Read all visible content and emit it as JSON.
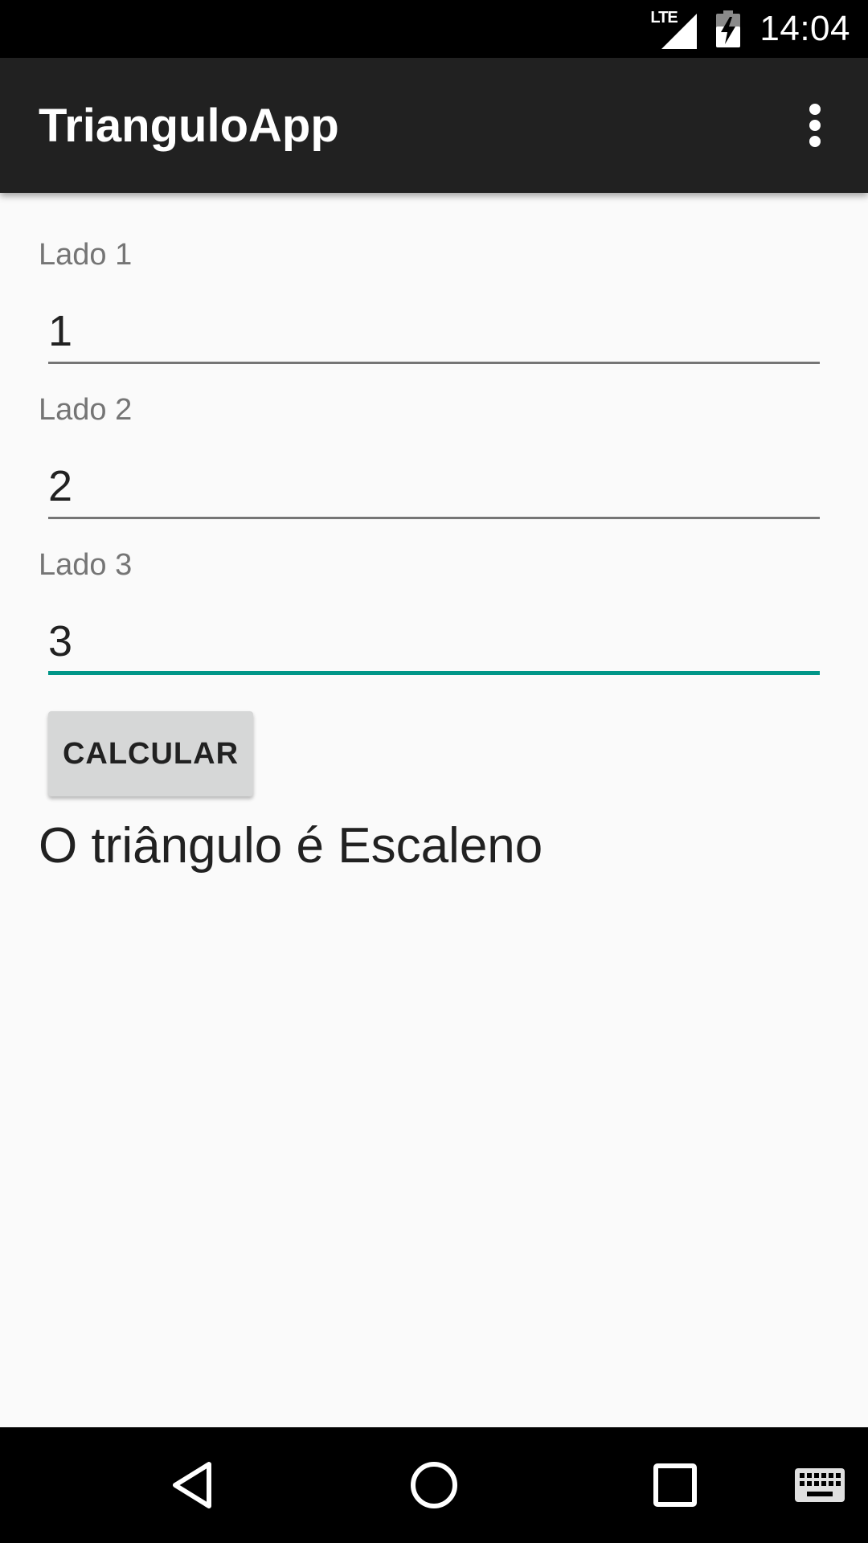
{
  "status_bar": {
    "network_label": "LTE",
    "signal_icon": "cell-signal-icon",
    "battery_icon": "battery-charging-icon",
    "time": "14:04"
  },
  "app_bar": {
    "title": "TrianguloApp",
    "overflow_icon": "more-vert-icon"
  },
  "form": {
    "fields": [
      {
        "label": "Lado 1",
        "value": "1",
        "focused": false
      },
      {
        "label": "Lado 2",
        "value": "2",
        "focused": false
      },
      {
        "label": "Lado 3",
        "value": "3",
        "focused": true
      }
    ],
    "button_label": "CALCULAR",
    "result": "O triângulo é Escaleno"
  },
  "nav_bar": {
    "back_icon": "back-icon",
    "home_icon": "home-icon",
    "recents_icon": "recents-icon",
    "keyboard_icon": "keyboard-icon"
  },
  "colors": {
    "accent": "#009688",
    "app_bar": "#212121",
    "background": "#fafafa",
    "button": "#d6d7d7"
  }
}
